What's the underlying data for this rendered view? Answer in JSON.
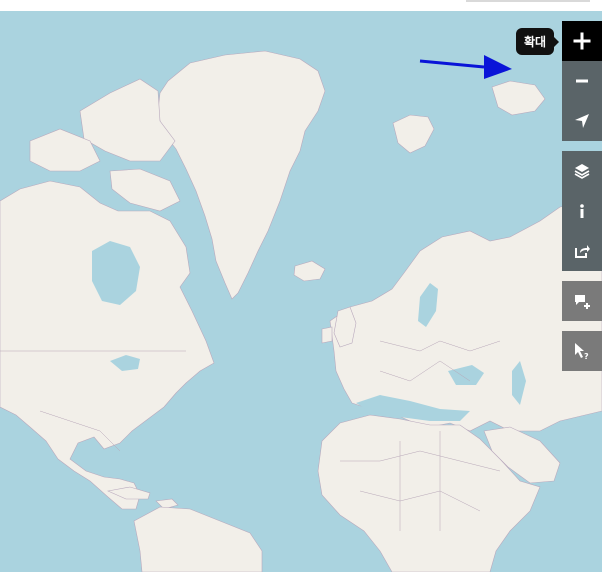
{
  "map": {
    "colors": {
      "water": "#aad3df",
      "land": "#f2efe9",
      "border": "#b7a6b7"
    }
  },
  "controls": {
    "zoom_in": {
      "icon": "plus-icon"
    },
    "zoom_out": {
      "icon": "minus-icon"
    },
    "locate": {
      "icon": "location-arrow-icon"
    },
    "layers": {
      "icon": "layers-icon"
    },
    "info": {
      "icon": "info-icon"
    },
    "share": {
      "icon": "share-icon"
    },
    "note": {
      "icon": "add-note-icon"
    },
    "query": {
      "icon": "query-features-icon"
    }
  },
  "tooltip": {
    "text": "확대"
  },
  "annotation": {
    "arrow_color": "#0a14d8"
  }
}
